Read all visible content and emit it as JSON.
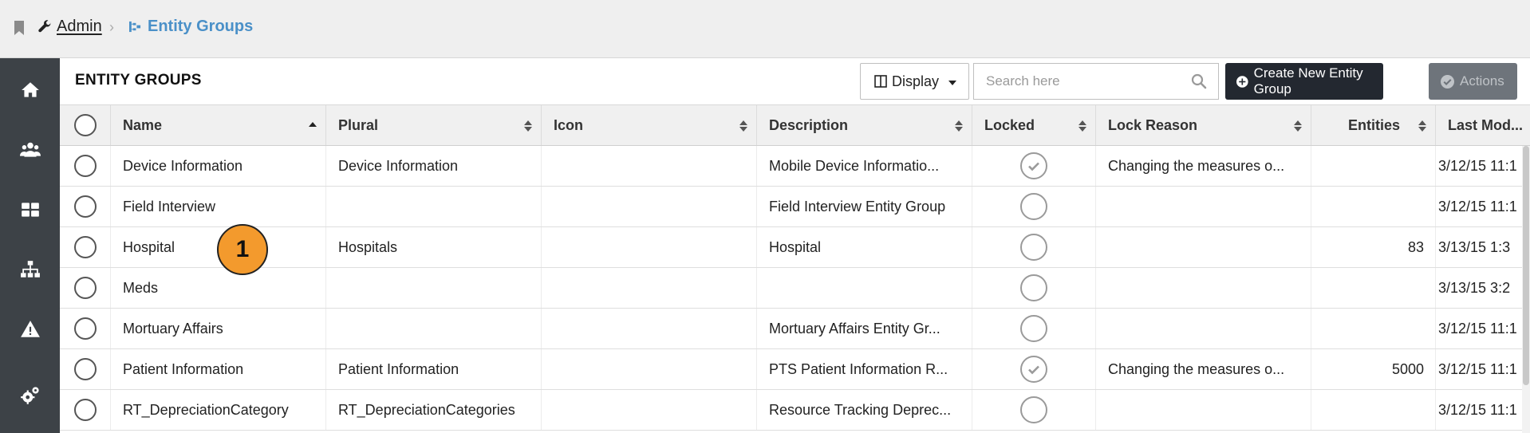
{
  "breadcrumb": {
    "admin": "Admin",
    "separator": "›",
    "current": "Entity Groups"
  },
  "page_title": "ENTITY GROUPS",
  "toolbar": {
    "display_label": "Display",
    "search_placeholder": "Search here",
    "create_label": "Create New Entity Group",
    "actions_label": "Actions"
  },
  "sidebar": {
    "items": [
      {
        "icon": "home-icon"
      },
      {
        "icon": "users-icon"
      },
      {
        "icon": "dashboard-icon"
      },
      {
        "icon": "hierarchy-icon"
      },
      {
        "icon": "warning-icon"
      },
      {
        "icon": "gears-icon"
      }
    ]
  },
  "table": {
    "columns": {
      "name": "Name",
      "plural": "Plural",
      "icon": "Icon",
      "description": "Description",
      "locked": "Locked",
      "lock_reason": "Lock Reason",
      "entities": "Entities",
      "last_modified": "Last Mod..."
    },
    "rows": [
      {
        "name": "Device Information",
        "plural": "Device Information",
        "description": "Mobile Device Informatio...",
        "locked": true,
        "lock_reason": "Changing the measures o...",
        "entities": "",
        "last_modified": "3/12/15 11:1"
      },
      {
        "name": "Field Interview",
        "plural": "",
        "description": "Field Interview Entity Group",
        "locked": false,
        "lock_reason": "",
        "entities": "",
        "last_modified": "3/12/15 11:1"
      },
      {
        "name": "Hospital",
        "plural": "Hospitals",
        "description": "Hospital",
        "locked": false,
        "lock_reason": "",
        "entities": "83",
        "last_modified": "3/13/15 1:3"
      },
      {
        "name": "Meds",
        "plural": "",
        "description": "",
        "locked": false,
        "lock_reason": "",
        "entities": "",
        "last_modified": "3/13/15 3:2"
      },
      {
        "name": "Mortuary Affairs",
        "plural": "",
        "description": "Mortuary Affairs Entity Gr...",
        "locked": false,
        "lock_reason": "",
        "entities": "",
        "last_modified": "3/12/15 11:1"
      },
      {
        "name": "Patient Information",
        "plural": "Patient Information",
        "description": "PTS Patient Information R...",
        "locked": true,
        "lock_reason": "Changing the measures o...",
        "entities": "5000",
        "last_modified": "3/12/15 11:1"
      },
      {
        "name": "RT_DepreciationCategory",
        "plural": "RT_DepreciationCategories",
        "description": "Resource Tracking Deprec...",
        "locked": false,
        "lock_reason": "",
        "entities": "",
        "last_modified": "3/12/15 11:1"
      }
    ]
  },
  "callout_badge": "1",
  "colors": {
    "accent": "#4a90c8",
    "sidebar": "#3d4247",
    "primary_button": "#232830",
    "badge": "#f39a2d"
  }
}
